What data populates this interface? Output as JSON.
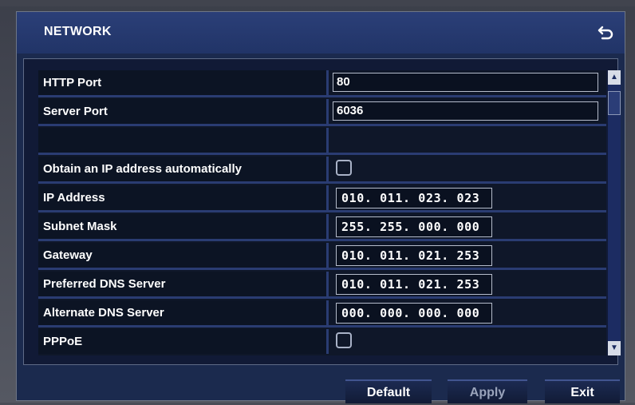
{
  "window": {
    "title": "NETWORK",
    "back_icon": "return-arrow-icon"
  },
  "rows": [
    {
      "label": "HTTP Port",
      "type": "text",
      "value": "80"
    },
    {
      "label": "Server Port",
      "type": "text",
      "value": "6036"
    },
    {
      "label": "",
      "type": "empty",
      "value": ""
    },
    {
      "label": "Obtain an IP address automatically",
      "type": "checkbox",
      "checked": false
    },
    {
      "label": "IP Address",
      "type": "ip",
      "value": "010. 011. 023. 023"
    },
    {
      "label": "Subnet Mask",
      "type": "ip",
      "value": "255. 255. 000. 000"
    },
    {
      "label": "Gateway",
      "type": "ip",
      "value": "010. 011. 021. 253"
    },
    {
      "label": "Preferred DNS Server",
      "type": "ip",
      "value": "010. 011. 021. 253"
    },
    {
      "label": "Alternate DNS Server",
      "type": "ip",
      "value": "000. 000. 000. 000"
    },
    {
      "label": "PPPoE",
      "type": "checkbox",
      "checked": false
    }
  ],
  "buttons": {
    "default": "Default",
    "apply": "Apply",
    "exit": "Exit"
  },
  "colors": {
    "title_bar": "#213467",
    "panel_bg": "#111a36",
    "row_divider": "#2a3c72",
    "text": "#ffffff"
  }
}
